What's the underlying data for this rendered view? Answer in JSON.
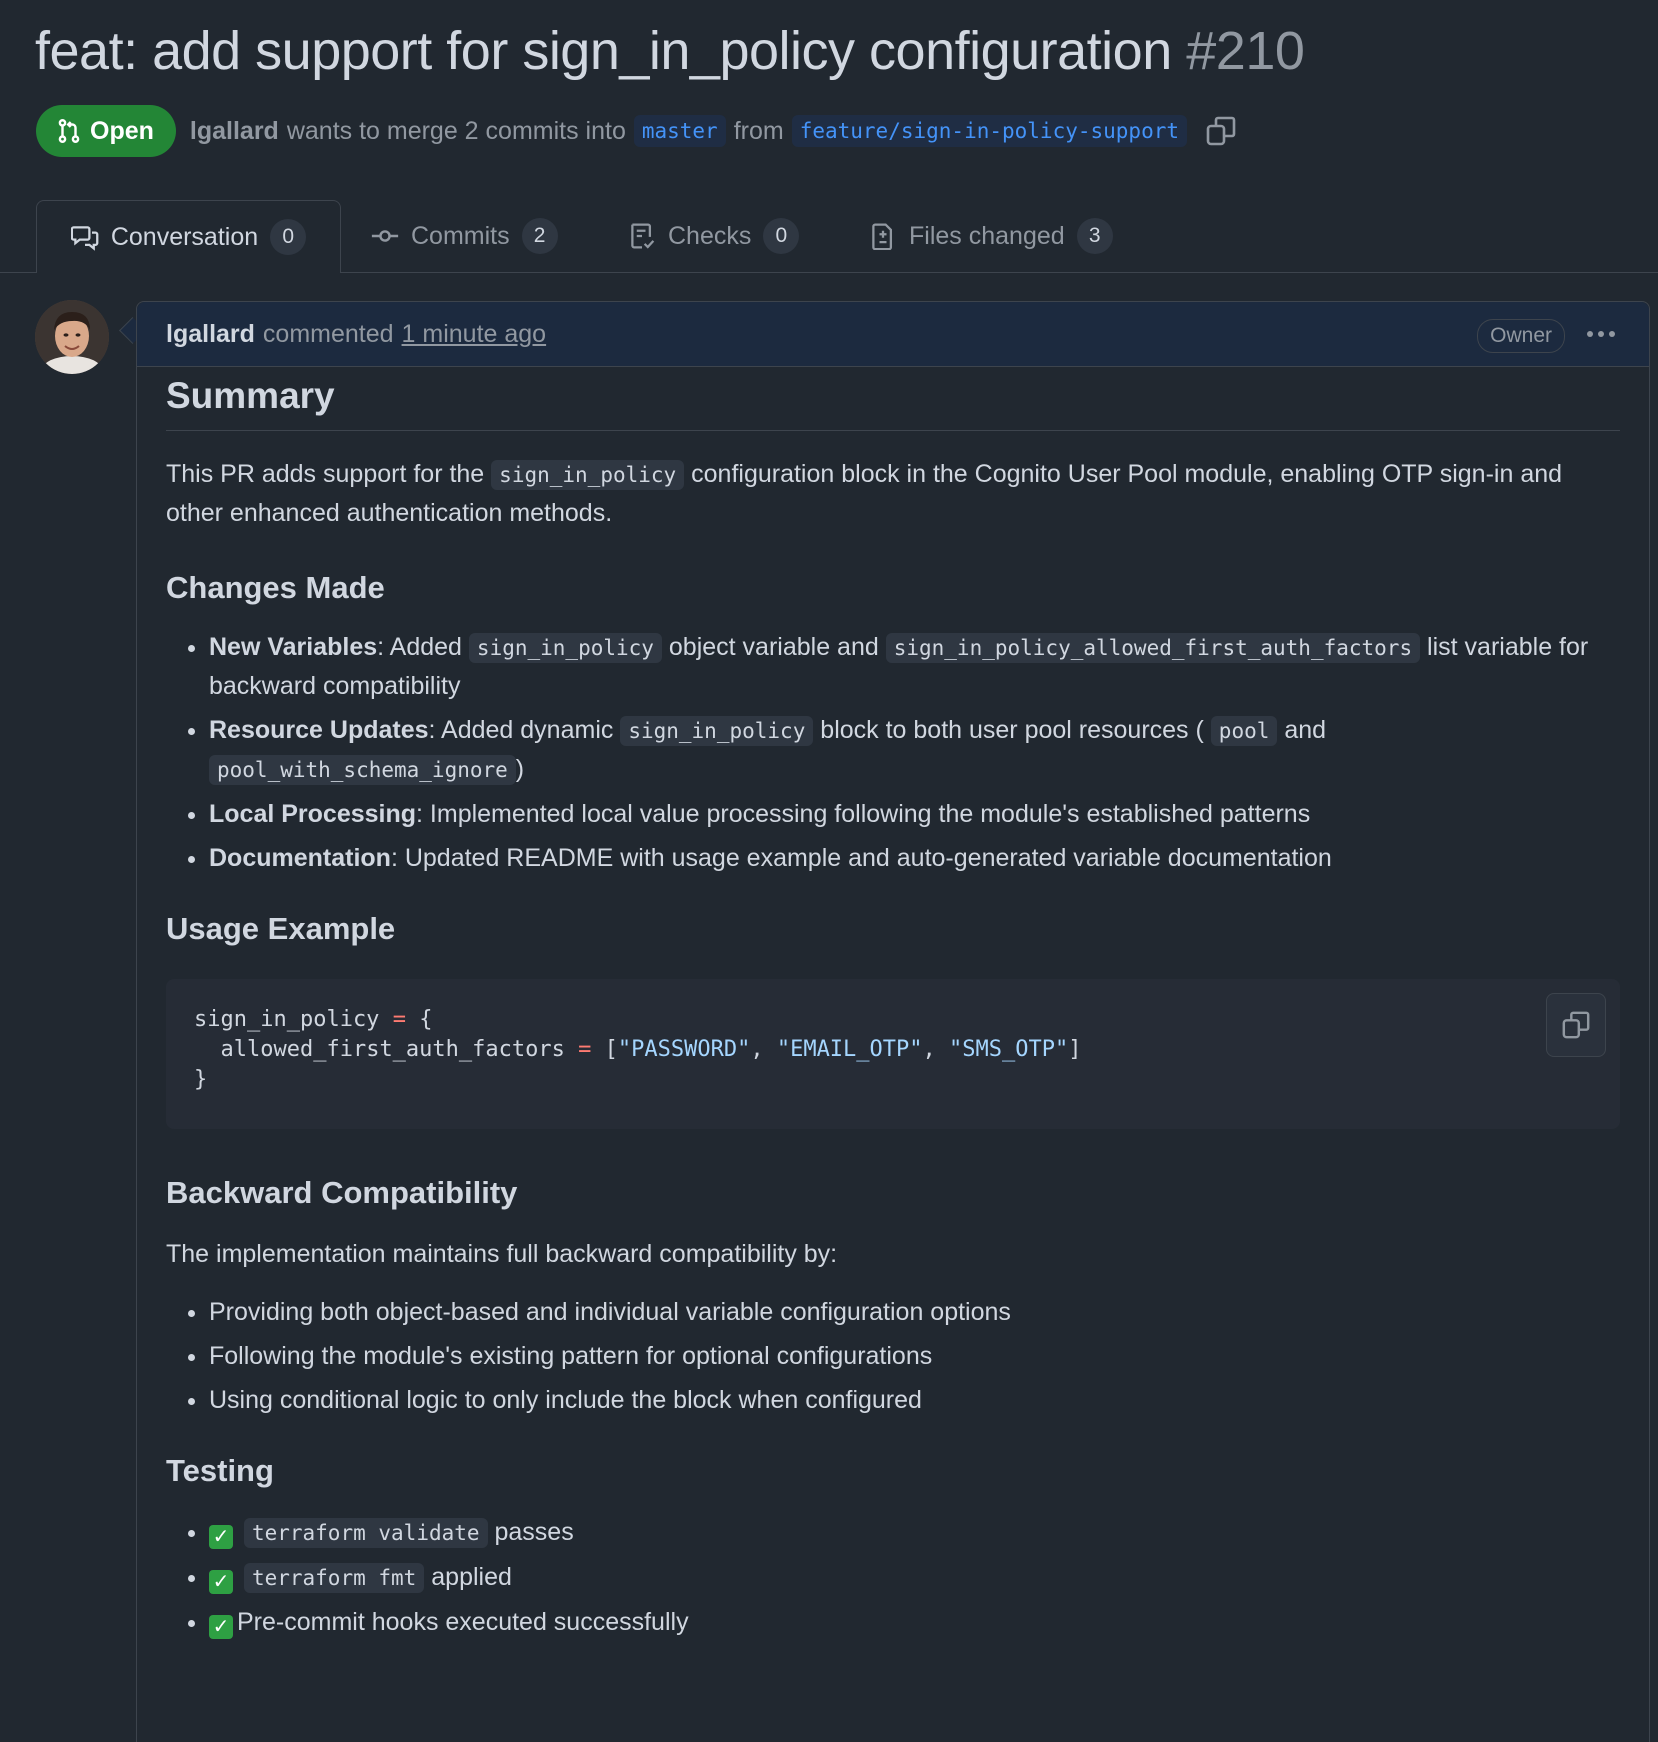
{
  "pr": {
    "title": "feat: add support for sign_in_policy configuration",
    "number": "#210",
    "state": "Open",
    "author": "lgallard",
    "merge_text": "wants to merge 2 commits into",
    "base_branch": "master",
    "from_text": "from",
    "head_branch": "feature/sign-in-policy-support"
  },
  "tabs": [
    {
      "label": "Conversation",
      "count": "0"
    },
    {
      "label": "Commits",
      "count": "2"
    },
    {
      "label": "Checks",
      "count": "0"
    },
    {
      "label": "Files changed",
      "count": "3"
    }
  ],
  "comment": {
    "author": "lgallard",
    "action": "commented",
    "time": "1 minute ago",
    "role": "Owner"
  },
  "body": {
    "summary_heading": "Summary",
    "summary_p1": "This PR adds support for the",
    "summary_code": "sign_in_policy",
    "summary_p2": "configuration block in the Cognito User Pool module, enabling OTP sign-in and other enhanced authentication methods.",
    "changes_heading": "Changes Made",
    "changes": {
      "c1_label": "New Variables",
      "c1_t1": ": Added",
      "c1_code1": "sign_in_policy",
      "c1_t2": "object variable and",
      "c1_code2": "sign_in_policy_allowed_first_auth_factors",
      "c1_t3": "list variable for backward compatibility",
      "c2_label": "Resource Updates",
      "c2_t1": ": Added dynamic",
      "c2_code1": "sign_in_policy",
      "c2_t2": "block to both user pool resources (",
      "c2_code2": "pool",
      "c2_t3": "and",
      "c2_code3": "pool_with_schema_ignore",
      "c2_t4": ")",
      "c3_label": "Local Processing",
      "c3_t1": ": Implemented local value processing following the module's established patterns",
      "c4_label": "Documentation",
      "c4_t1": ": Updated README with usage example and auto-generated variable documentation"
    },
    "usage_heading": "Usage Example",
    "code": {
      "l1_name": "sign_in_policy",
      "l1_op": "=",
      "l1_brace": "{",
      "l2_name": "allowed_first_auth_factors",
      "l2_op": "=",
      "l2_open": "[",
      "s1": "\"PASSWORD\"",
      "comma": ",",
      "s2": "\"EMAIL_OTP\"",
      "s3": "\"SMS_OTP\"",
      "l2_close": "]",
      "l3": "}"
    },
    "compat_heading": "Backward Compatibility",
    "compat_intro": "The implementation maintains full backward compatibility by:",
    "compat_items": [
      "Providing both object-based and individual variable configuration options",
      "Following the module's existing pattern for optional configurations",
      "Using conditional logic to only include the block when configured"
    ],
    "testing_heading": "Testing",
    "testing": {
      "t1_code": "terraform validate",
      "t1_text": "passes",
      "t2_code": "terraform fmt",
      "t2_text": "applied",
      "t3_text": "Pre-commit hooks executed successfully",
      "check_glyph": "✓"
    }
  },
  "colors": {
    "background": "#212830",
    "open_badge": "#238636",
    "link": "#4493f8",
    "header_bg": "#1c2a3f"
  }
}
